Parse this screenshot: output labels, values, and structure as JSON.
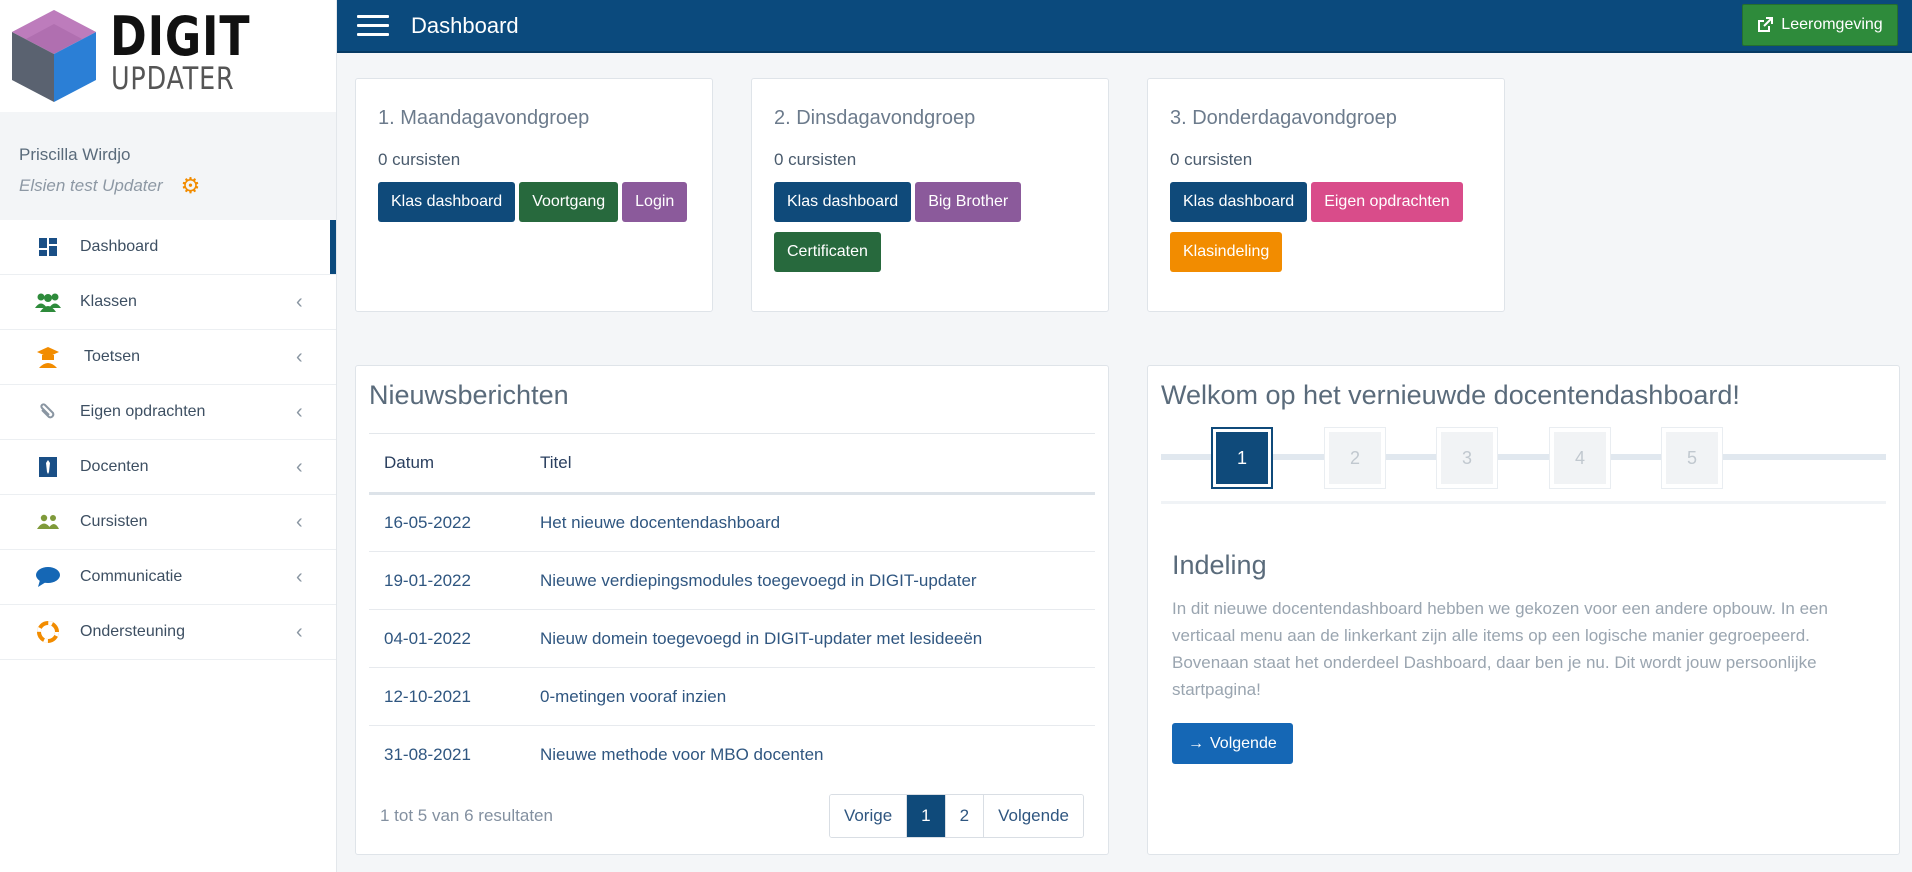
{
  "logo": {
    "line1": "DIGIT",
    "line2": "UPDATER"
  },
  "user": {
    "name": "Priscilla Wirdjo",
    "org": "Elsien test Updater"
  },
  "menu": [
    {
      "label": "Dashboard",
      "icon": "dashboard-icon",
      "active": true
    },
    {
      "label": "Klassen",
      "icon": "people-group-icon"
    },
    {
      "label": "Toetsen",
      "icon": "graduate-icon"
    },
    {
      "label": "Eigen opdrachten",
      "icon": "paperclip-icon"
    },
    {
      "label": "Docenten",
      "icon": "tie-icon"
    },
    {
      "label": "Cursisten",
      "icon": "users-icon"
    },
    {
      "label": "Communicatie",
      "icon": "speech-bubble-icon"
    },
    {
      "label": "Ondersteuning",
      "icon": "lifebuoy-icon"
    }
  ],
  "topbar": {
    "title": "Dashboard",
    "button": "Leeromgeving"
  },
  "groups": [
    {
      "title": "1. Maandagavondgroep",
      "count": "0 cursisten",
      "buttons": [
        "Klas dashboard",
        "Voortgang",
        "Login"
      ]
    },
    {
      "title": "2. Dinsdagavondgroep",
      "count": "0 cursisten",
      "buttons": [
        "Klas dashboard",
        "Big Brother",
        "Certificaten"
      ]
    },
    {
      "title": "3. Donderdagavondgroep",
      "count": "0 cursisten",
      "buttons": [
        "Klas dashboard",
        "Eigen opdrachten",
        "Klasindeling"
      ]
    }
  ],
  "news": {
    "title": "Nieuwsberichten",
    "columns": [
      "Datum",
      "Titel"
    ],
    "rows": [
      {
        "date": "16-05-2022",
        "title": "Het nieuwe docentendashboard"
      },
      {
        "date": "19-01-2022",
        "title": "Nieuwe verdiepingsmodules toegevoegd in DIGIT-updater"
      },
      {
        "date": "04-01-2022",
        "title": "Nieuw domein toegevoegd in DIGIT-updater met lesideeën"
      },
      {
        "date": "12-10-2021",
        "title": "0-metingen vooraf inzien"
      },
      {
        "date": "31-08-2021",
        "title": "Nieuwe methode voor MBO docenten"
      }
    ],
    "result_text": "1 tot 5 van 6 resultaten",
    "pager": {
      "prev": "Vorige",
      "page1": "1",
      "page2": "2",
      "next": "Volgende"
    }
  },
  "welcome": {
    "title": "Welkom op het vernieuwde docentendashboard!",
    "steps": [
      "1",
      "2",
      "3",
      "4",
      "5"
    ],
    "active_step": 1,
    "heading": "Indeling",
    "text": "In dit nieuwe docentendashboard hebben we gekozen voor een andere opbouw. In een verticaal menu aan de linkerkant zijn alle items op een logische manier gegroepeerd. Bovenaan staat het onderdeel Dashboard, daar ben je nu. Dit wordt jouw persoonlijke startpagina!",
    "next_button": "Volgende"
  },
  "colors": {
    "navy": "#0b4a7d",
    "green": "#2e8b3b",
    "dark_green": "#27693d",
    "purple": "#8b5a9b",
    "pink": "#d94c8a",
    "orange": "#f28c00",
    "blue": "#1567b5"
  }
}
